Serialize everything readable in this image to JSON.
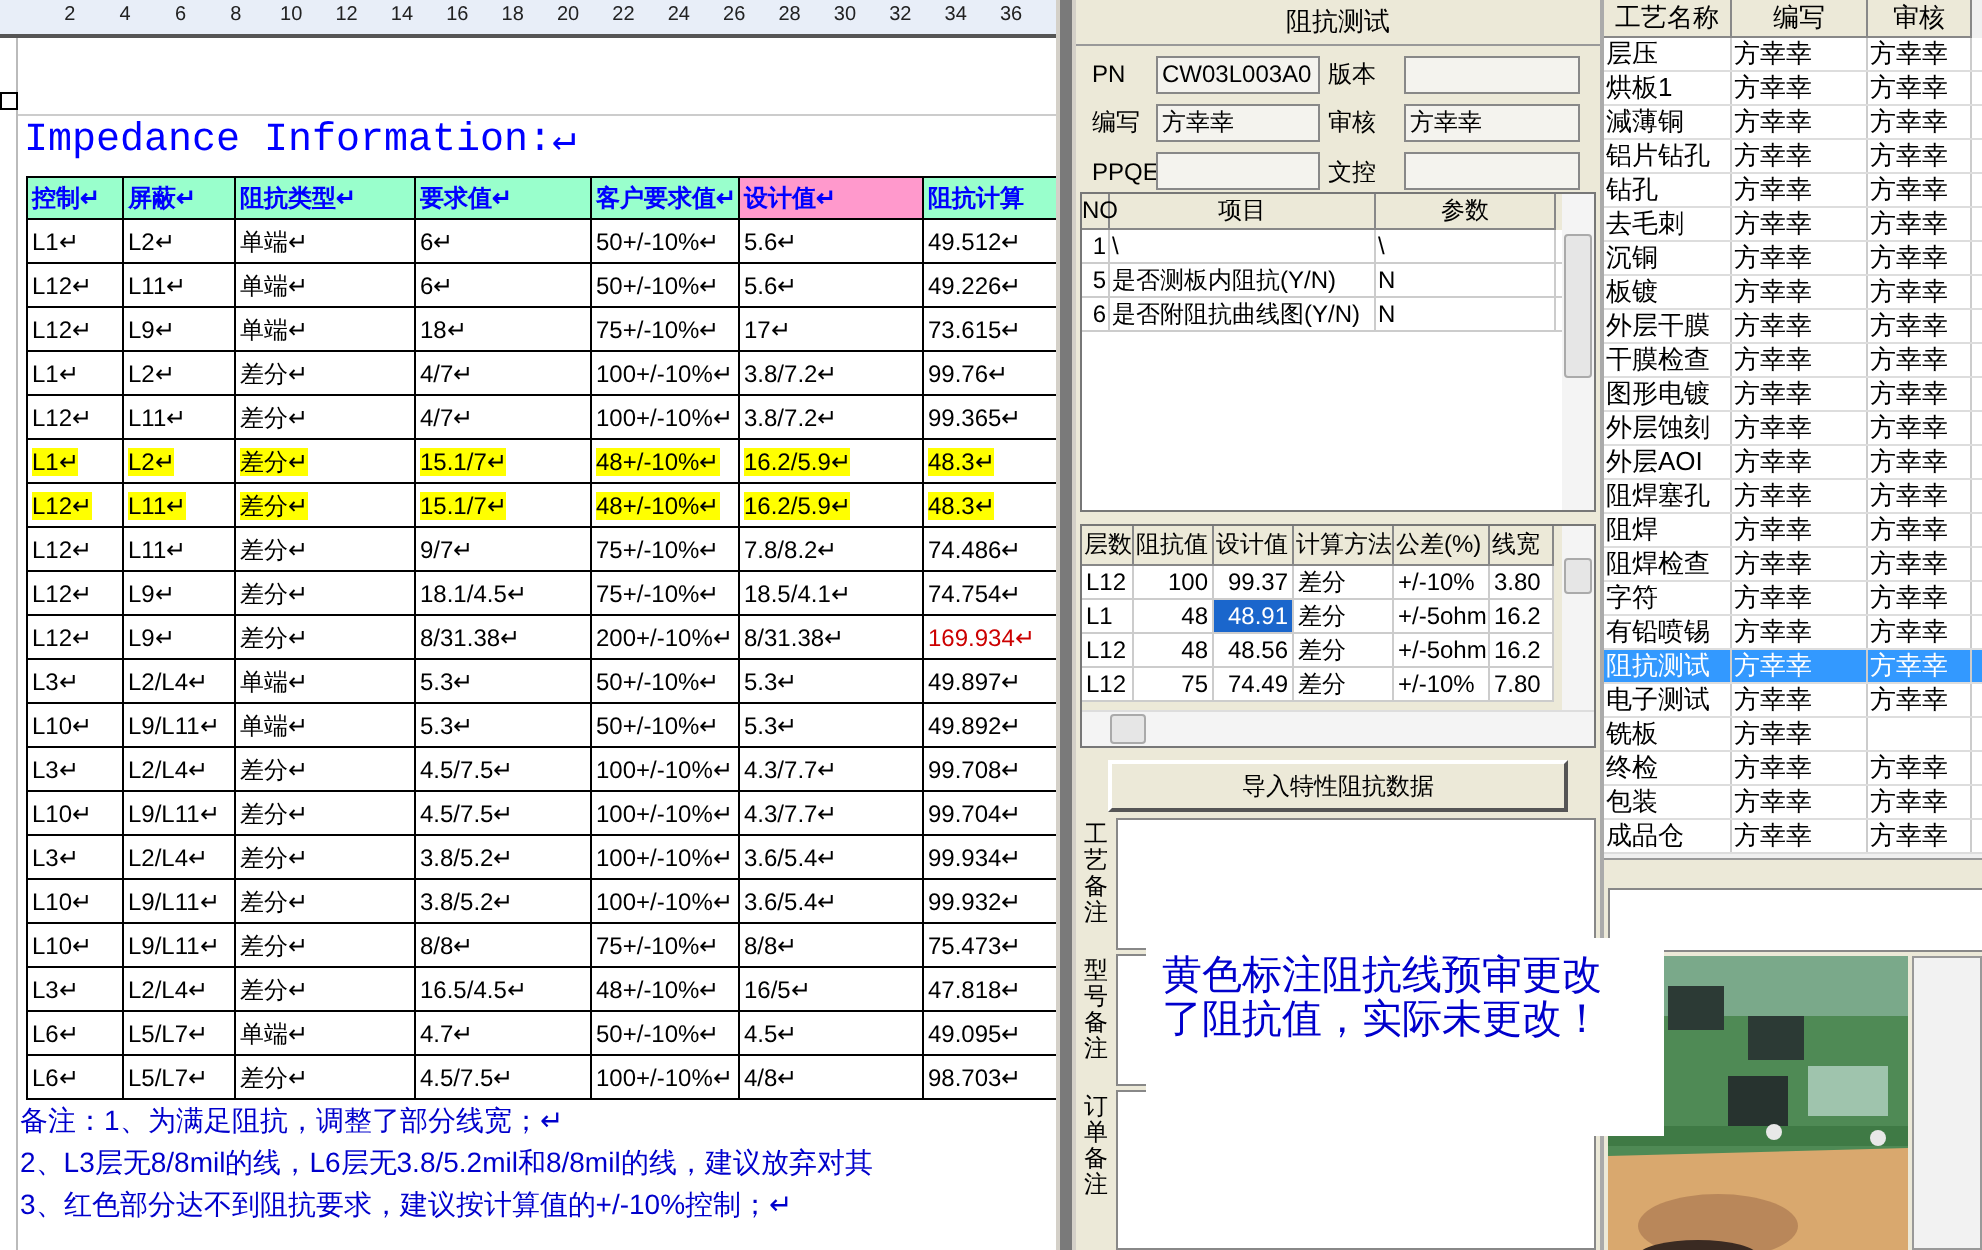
{
  "document": {
    "ruler_labels": [
      "2",
      "4",
      "6",
      "8",
      "10",
      "12",
      "14",
      "16",
      "18",
      "20",
      "22",
      "24",
      "26",
      "28",
      "30",
      "32",
      "34",
      "36"
    ],
    "title": "Impedance Information:↵",
    "table": {
      "columns": [
        {
          "label": "控制↵",
          "color": "#99ffcc"
        },
        {
          "label": "屏蔽↵",
          "color": "#99ffcc"
        },
        {
          "label": "阻抗类型↵",
          "color": "#99ffcc"
        },
        {
          "label": "要求值↵",
          "color": "#99ffcc"
        },
        {
          "label": "客户要求值↵",
          "color": "#99ffcc"
        },
        {
          "label": "设计值↵",
          "color": "#ff99cc"
        },
        {
          "label": "阻抗计算",
          "color": "#99ffcc"
        }
      ],
      "rows": [
        {
          "cells": [
            "L1↵",
            "L2↵",
            "单端↵",
            "6↵",
            "50+/-10%↵",
            "5.6↵",
            "49.512↵"
          ],
          "highlighted": false,
          "flagged": false
        },
        {
          "cells": [
            "L12↵",
            "L11↵",
            "单端↵",
            "6↵",
            "50+/-10%↵",
            "5.6↵",
            "49.226↵"
          ],
          "highlighted": false,
          "flagged": false
        },
        {
          "cells": [
            "L12↵",
            "L9↵",
            "单端↵",
            "18↵",
            "75+/-10%↵",
            "17↵",
            "73.615↵"
          ],
          "highlighted": false,
          "flagged": false
        },
        {
          "cells": [
            "L1↵",
            "L2↵",
            "差分↵",
            "4/7↵",
            "100+/-10%↵",
            "3.8/7.2↵",
            "99.76↵"
          ],
          "highlighted": false,
          "flagged": false
        },
        {
          "cells": [
            "L12↵",
            "L11↵",
            "差分↵",
            "4/7↵",
            "100+/-10%↵",
            "3.8/7.2↵",
            "99.365↵"
          ],
          "highlighted": false,
          "flagged": false
        },
        {
          "cells": [
            "L1↵",
            "L2↵",
            "差分↵",
            "15.1/7↵",
            "48+/-10%↵",
            "16.2/5.9↵",
            "48.3↵"
          ],
          "highlighted": true,
          "flagged": false
        },
        {
          "cells": [
            "L12↵",
            "L11↵",
            "差分↵",
            "15.1/7↵",
            "48+/-10%↵",
            "16.2/5.9↵",
            "48.3↵"
          ],
          "highlighted": true,
          "flagged": false
        },
        {
          "cells": [
            "L12↵",
            "L11↵",
            "差分↵",
            "9/7↵",
            "75+/-10%↵",
            "7.8/8.2↵",
            "74.486↵"
          ],
          "highlighted": false,
          "flagged": false
        },
        {
          "cells": [
            "L12↵",
            "L9↵",
            "差分↵",
            "18.1/4.5↵",
            "75+/-10%↵",
            "18.5/4.1↵",
            "74.754↵"
          ],
          "highlighted": false,
          "flagged": false
        },
        {
          "cells": [
            "L12↵",
            "L9↵",
            "差分↵",
            "8/31.38↵",
            "200+/-10%↵",
            "8/31.38↵",
            "169.934↵"
          ],
          "highlighted": false,
          "flagged": true
        },
        {
          "cells": [
            "L3↵",
            "L2/L4↵",
            "单端↵",
            "5.3↵",
            "50+/-10%↵",
            "5.3↵",
            "49.897↵"
          ],
          "highlighted": false,
          "flagged": false
        },
        {
          "cells": [
            "L10↵",
            "L9/L11↵",
            "单端↵",
            "5.3↵",
            "50+/-10%↵",
            "5.3↵",
            "49.892↵"
          ],
          "highlighted": false,
          "flagged": false
        },
        {
          "cells": [
            "L3↵",
            "L2/L4↵",
            "差分↵",
            "4.5/7.5↵",
            "100+/-10%↵",
            "4.3/7.7↵",
            "99.708↵"
          ],
          "highlighted": false,
          "flagged": false
        },
        {
          "cells": [
            "L10↵",
            "L9/L11↵",
            "差分↵",
            "4.5/7.5↵",
            "100+/-10%↵",
            "4.3/7.7↵",
            "99.704↵"
          ],
          "highlighted": false,
          "flagged": false
        },
        {
          "cells": [
            "L3↵",
            "L2/L4↵",
            "差分↵",
            "3.8/5.2↵",
            "100+/-10%↵",
            "3.6/5.4↵",
            "99.934↵"
          ],
          "highlighted": false,
          "flagged": false
        },
        {
          "cells": [
            "L10↵",
            "L9/L11↵",
            "差分↵",
            "3.8/5.2↵",
            "100+/-10%↵",
            "3.6/5.4↵",
            "99.932↵"
          ],
          "highlighted": false,
          "flagged": false
        },
        {
          "cells": [
            "L10↵",
            "L9/L11↵",
            "差分↵",
            "8/8↵",
            "75+/-10%↵",
            "8/8↵",
            "75.473↵"
          ],
          "highlighted": false,
          "flagged": false
        },
        {
          "cells": [
            "L3↵",
            "L2/L4↵",
            "差分↵",
            "16.5/4.5↵",
            "48+/-10%↵",
            "16/5↵",
            "47.818↵"
          ],
          "highlighted": false,
          "flagged": false
        },
        {
          "cells": [
            "L6↵",
            "L5/L7↵",
            "单端↵",
            "4.7↵",
            "50+/-10%↵",
            "4.5↵",
            "49.095↵"
          ],
          "highlighted": false,
          "flagged": false
        },
        {
          "cells": [
            "L6↵",
            "L5/L7↵",
            "差分↵",
            "4.5/7.5↵",
            "100+/-10%↵",
            "4/8↵",
            "98.703↵"
          ],
          "highlighted": false,
          "flagged": false
        }
      ]
    },
    "notes": [
      "备注：1、为满足阻抗，调整了部分线宽；↵",
      "2、L3层无8/8mil的线，L6层无3.8/5.2mil和8/8mil的线，建议放弃对其",
      "3、红色部分达不到阻抗要求，建议按计算值的+/-10%控制；↵"
    ]
  },
  "panel": {
    "title": "阻抗测试",
    "fields": [
      {
        "label": "PN",
        "value": "CW03L003A0"
      },
      {
        "label": "版本"
      },
      {
        "label": "编写",
        "value": "方幸幸"
      },
      {
        "label": "审核",
        "value": "方幸幸"
      },
      {
        "label": "PPQE"
      },
      {
        "label": "文控"
      }
    ],
    "items_grid": {
      "columns": [
        "NO",
        "项目",
        "参数"
      ],
      "rows": [
        [
          "1",
          "\\",
          "\\"
        ],
        [
          "5",
          "是否测板内阻抗(Y/N)",
          "N"
        ],
        [
          "6",
          "是否附阻抗曲线图(Y/N)",
          "N"
        ]
      ]
    },
    "impedance_grid": {
      "columns": [
        "层数",
        "阻抗值",
        "设计值",
        "计算方法",
        "公差(%)",
        "线宽"
      ],
      "rows": [
        {
          "cells": [
            "L12",
            "100",
            "99.37",
            "差分",
            "+/-10%",
            "3.80"
          ],
          "selected": false
        },
        {
          "cells": [
            "L1",
            "48",
            "48.91",
            "差分",
            "+/-5ohm",
            "16.2"
          ],
          "selected": true
        },
        {
          "cells": [
            "L12",
            "48",
            "48.56",
            "差分",
            "+/-5ohm",
            "16.2"
          ],
          "selected": false
        },
        {
          "cells": [
            "L12",
            "75",
            "74.49",
            "差分",
            "+/-10%",
            "7.80"
          ],
          "selected": false
        }
      ]
    },
    "import_button": "导入特性阻抗数据",
    "remark_tabs": [
      "工艺备注",
      "型号备注",
      "订单备注"
    ]
  },
  "overlay_note": [
    "黄色标注阻抗线预审更改",
    "了阻抗值，实际未更改！"
  ],
  "process_grid": {
    "columns": [
      "工艺名称",
      "编写",
      "审核"
    ],
    "rows": [
      {
        "cells": [
          "层压",
          "方幸幸",
          "方幸幸"
        ],
        "selected": false
      },
      {
        "cells": [
          "烘板1",
          "方幸幸",
          "方幸幸"
        ],
        "selected": false
      },
      {
        "cells": [
          "減薄铜",
          "方幸幸",
          "方幸幸"
        ],
        "selected": false
      },
      {
        "cells": [
          "铝片钻孔",
          "方幸幸",
          "方幸幸"
        ],
        "selected": false
      },
      {
        "cells": [
          "钻孔",
          "方幸幸",
          "方幸幸"
        ],
        "selected": false
      },
      {
        "cells": [
          "去毛刺",
          "方幸幸",
          "方幸幸"
        ],
        "selected": false
      },
      {
        "cells": [
          "沉铜",
          "方幸幸",
          "方幸幸"
        ],
        "selected": false
      },
      {
        "cells": [
          "板镀",
          "方幸幸",
          "方幸幸"
        ],
        "selected": false
      },
      {
        "cells": [
          "外层干膜",
          "方幸幸",
          "方幸幸"
        ],
        "selected": false
      },
      {
        "cells": [
          "干膜检查",
          "方幸幸",
          "方幸幸"
        ],
        "selected": false
      },
      {
        "cells": [
          "图形电镀",
          "方幸幸",
          "方幸幸"
        ],
        "selected": false
      },
      {
        "cells": [
          "外层蚀刻",
          "方幸幸",
          "方幸幸"
        ],
        "selected": false
      },
      {
        "cells": [
          "外层AOI",
          "方幸幸",
          "方幸幸"
        ],
        "selected": false
      },
      {
        "cells": [
          "阻焊塞孔",
          "方幸幸",
          "方幸幸"
        ],
        "selected": false
      },
      {
        "cells": [
          "阻焊",
          "方幸幸",
          "方幸幸"
        ],
        "selected": false
      },
      {
        "cells": [
          "阻焊检查",
          "方幸幸",
          "方幸幸"
        ],
        "selected": false
      },
      {
        "cells": [
          "字符",
          "方幸幸",
          "方幸幸"
        ],
        "selected": false
      },
      {
        "cells": [
          "有铅喷锡",
          "方幸幸",
          "方幸幸"
        ],
        "selected": false
      },
      {
        "cells": [
          "阻抗测试",
          "方幸幸",
          "方幸幸"
        ],
        "selected": true
      },
      {
        "cells": [
          "电子测试",
          "方幸幸",
          "方幸幸"
        ],
        "selected": false
      },
      {
        "cells": [
          "铣板",
          "方幸幸"
        ],
        "selected": false
      },
      {
        "cells": [
          "终检",
          "方幸幸",
          "方幸幸"
        ],
        "selected": false
      },
      {
        "cells": [
          "包装",
          "方幸幸",
          "方幸幸"
        ],
        "selected": false
      },
      {
        "cells": [
          "成品仓",
          "方幸幸",
          "方幸幸"
        ],
        "selected": false
      }
    ]
  },
  "photo": {
    "kind": "picture"
  }
}
